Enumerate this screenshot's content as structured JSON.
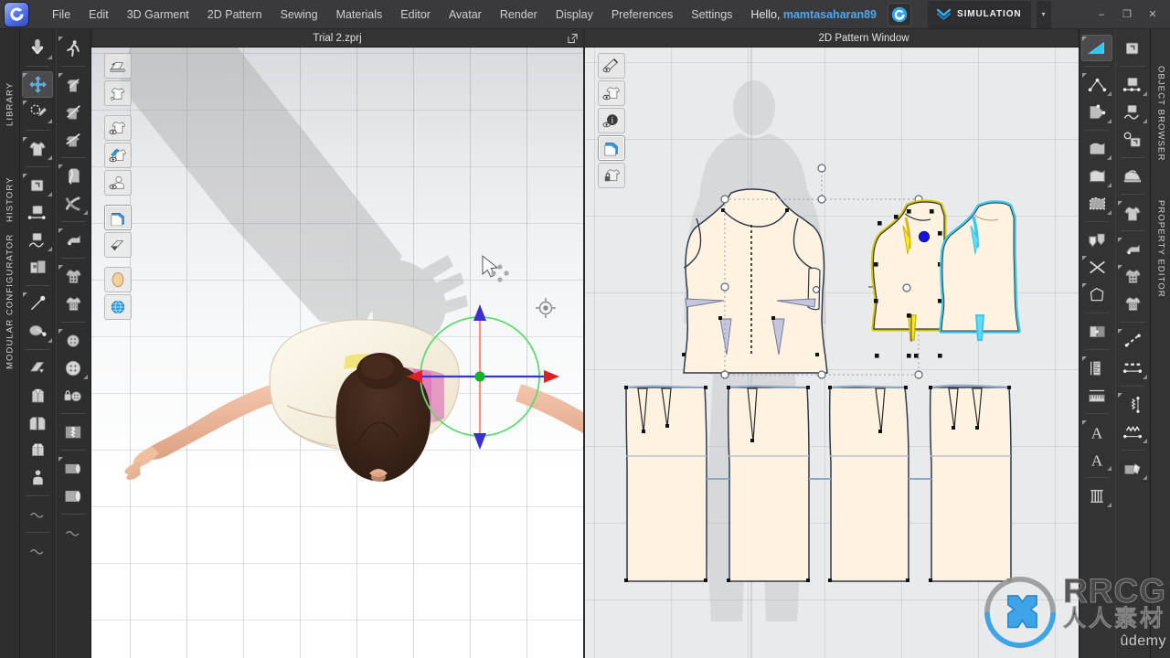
{
  "app": {
    "logo_icon": "clo-logo-icon",
    "window_controls": [
      {
        "name": "minimize",
        "glyph": "–"
      },
      {
        "name": "restore",
        "glyph": "❐"
      },
      {
        "name": "close",
        "glyph": "✕"
      }
    ]
  },
  "menubar": {
    "items": [
      {
        "label": "File"
      },
      {
        "label": "Edit"
      },
      {
        "label": "3D Garment"
      },
      {
        "label": "2D Pattern"
      },
      {
        "label": "Sewing"
      },
      {
        "label": "Materials"
      },
      {
        "label": "Editor"
      },
      {
        "label": "Avatar"
      },
      {
        "label": "Render"
      },
      {
        "label": "Display"
      },
      {
        "label": "Preferences"
      },
      {
        "label": "Settings"
      }
    ],
    "greeting_prefix": "Hello, ",
    "greeting_user": "mamtasaharan89",
    "account_icon": "clo-account-icon",
    "simulation_label": "SIMULATION",
    "simulation_icon": "simulation-chevrons-icon",
    "simulation_caret": "▾"
  },
  "left_rail": {
    "tabs": [
      {
        "label": "LIBRARY"
      },
      {
        "label": "HISTORY"
      },
      {
        "label": "MODULAR CONFIGURATOR"
      }
    ]
  },
  "right_rail": {
    "tabs": [
      {
        "label": "OBJECT BROWSER"
      },
      {
        "label": "PROPERTY EDITOR"
      }
    ]
  },
  "panels": {
    "viewport_3d": {
      "title": "Trial 2.zprj",
      "popout_icon": "popout-icon",
      "toolbar": [
        {
          "icon": "render-box-icon",
          "selected": false,
          "sub": false
        },
        {
          "icon": "garment-thumbnail-icon",
          "selected": false,
          "sub": false
        },
        {
          "icon": "show-garment-icon",
          "selected": false,
          "sub": false
        },
        {
          "icon": "show-stitch-icon",
          "selected": false,
          "sub": false
        },
        {
          "icon": "show-avatar-icon",
          "selected": false,
          "sub": false
        },
        {
          "icon": "show-pattern-icon",
          "selected": true,
          "sub": false
        },
        {
          "icon": "shade-mode-icon",
          "selected": false,
          "sub": false
        },
        {
          "icon": "avatar-head-icon",
          "selected": false,
          "sub": false
        },
        {
          "icon": "globe-environment-icon",
          "selected": false,
          "sub": false
        }
      ]
    },
    "viewport_2d": {
      "title": "2D Pattern Window",
      "popout_icon": "popout-icon",
      "toolbar": [
        {
          "icon": "show-baseline-icon",
          "selected": false
        },
        {
          "icon": "show-pattern-icon",
          "selected": false
        },
        {
          "icon": "show-info-icon",
          "selected": false
        },
        {
          "icon": "show-texture-icon",
          "selected": true
        },
        {
          "icon": "lock-pattern-icon",
          "selected": false
        }
      ]
    }
  },
  "left_toolbar": {
    "column_a": [
      {
        "icon": "simulate-arrow-icon",
        "arrow_br": true
      },
      {
        "sep": true
      },
      {
        "icon": "transform-move-icon",
        "selected": true,
        "arrow_tl": true
      },
      {
        "icon": "select-mesh-brush-icon",
        "arrow_tl": true,
        "arrow_br": true
      },
      {
        "sep": true
      },
      {
        "icon": "select-garment-icon",
        "arrow_tl": true,
        "arrow_br": true
      },
      {
        "sep": true
      },
      {
        "icon": "fold-arrange-icon",
        "arrow_tl": true,
        "arrow_br": true
      },
      {
        "icon": "segment-line-icon"
      },
      {
        "icon": "curve-pin-icon",
        "arrow_br": true
      },
      {
        "icon": "fabric-layer-icon"
      },
      {
        "sep": true
      },
      {
        "icon": "tape-measure-icon",
        "arrow_tl": true
      },
      {
        "icon": "circumference-measure-icon",
        "arrow_br": true
      },
      {
        "sep": true
      },
      {
        "icon": "flatten-icon"
      },
      {
        "icon": "zipper-garment-icon"
      },
      {
        "icon": "panel-pair-icon"
      },
      {
        "icon": "box-open-icon"
      },
      {
        "icon": "avatar-pose-icon"
      },
      {
        "sep": true
      },
      {
        "icon": "wave-tool-icon"
      },
      {
        "sep": true
      },
      {
        "icon": "wave-tool-2-icon"
      }
    ],
    "column_b": [
      {
        "icon": "walk-animation-icon",
        "arrow_tl": true
      },
      {
        "sep": true
      },
      {
        "icon": "pin-garment-icon",
        "arrow_tl": true
      },
      {
        "icon": "tack-garment-icon"
      },
      {
        "icon": "tack-pattern-icon"
      },
      {
        "sep": true
      },
      {
        "icon": "sew-free-icon",
        "arrow_tl": true
      },
      {
        "icon": "sew-segment-icon",
        "arrow_br": true
      },
      {
        "sep": true
      },
      {
        "icon": "fold-arrangement-icon",
        "arrow_tl": true
      },
      {
        "sep": true
      },
      {
        "icon": "button-add-icon",
        "arrow_tl": true
      },
      {
        "icon": "buttonhole-icon"
      },
      {
        "sep": true
      },
      {
        "icon": "button-place-icon",
        "arrow_tl": true
      },
      {
        "icon": "button-detail-icon",
        "arrow_br": true
      },
      {
        "icon": "lock-button-icon"
      },
      {
        "sep": true
      },
      {
        "icon": "zipper-icon"
      },
      {
        "sep": true
      },
      {
        "icon": "roll-fabric-icon",
        "arrow_tl": true
      },
      {
        "icon": "fabric-bolt-icon"
      },
      {
        "sep": true
      },
      {
        "icon": "wave-tool-icon"
      }
    ]
  },
  "right_toolbar": {
    "column_a": [
      {
        "icon": "polygon-select-icon",
        "selected": true,
        "arrow_tl": true
      },
      {
        "sep": true
      },
      {
        "icon": "edit-point-icon",
        "arrow_tl": true,
        "arrow_br": true
      },
      {
        "icon": "edit-curve-icon",
        "arrow_br": true
      },
      {
        "sep": true
      },
      {
        "icon": "pattern-shape-icon",
        "arrow_br": true
      },
      {
        "icon": "pattern-outline-icon",
        "arrow_br": true
      },
      {
        "icon": "pattern-marquee-icon",
        "arrow_br": true
      },
      {
        "sep": true
      },
      {
        "icon": "trace-shape-icon"
      },
      {
        "icon": "cut-scissors-icon",
        "arrow_tl": true
      },
      {
        "icon": "polygon-draw-icon",
        "arrow_tl": true
      },
      {
        "sep": true
      },
      {
        "icon": "fold-panel-icon"
      },
      {
        "sep": true
      },
      {
        "icon": "ruler-grade-icon",
        "arrow_tl": true
      },
      {
        "icon": "ruler-measure-icon"
      },
      {
        "sep": true
      },
      {
        "icon": "text-tool-icon",
        "arrow_tl": true
      },
      {
        "icon": "text-style-icon",
        "arrow_br": true
      },
      {
        "sep": true
      },
      {
        "icon": "pleat-icon",
        "arrow_br": true
      }
    ],
    "column_b": [
      {
        "icon": "pattern-fold-icon"
      },
      {
        "sep": true
      },
      {
        "icon": "segment-points-icon",
        "arrow_br": true
      },
      {
        "icon": "curve-segment-icon",
        "arrow_br": true
      },
      {
        "icon": "search-pattern-icon"
      },
      {
        "sep": true
      },
      {
        "icon": "iron-press-icon"
      },
      {
        "sep": true
      },
      {
        "icon": "tshirt-pattern-icon",
        "arrow_tl": true
      },
      {
        "sep": true
      },
      {
        "icon": "button-place-icon",
        "arrow_tl": true
      },
      {
        "icon": "button-detail-icon",
        "arrow_tl": true
      },
      {
        "icon": "buttonhole-panel-icon"
      },
      {
        "sep": true
      },
      {
        "icon": "topstitch-icon",
        "arrow_tl": true
      },
      {
        "icon": "stitch-dash-icon",
        "arrow_br": true
      },
      {
        "sep": true
      },
      {
        "icon": "zigzag-line-icon",
        "arrow_tl": true
      },
      {
        "icon": "zigzag-stitch-icon",
        "arrow_br": true
      },
      {
        "sep": true
      },
      {
        "icon": "print-layout-icon",
        "arrow_br": true
      }
    ]
  },
  "scene_3d": {
    "avatar_description": "female-avatar-top-view",
    "gizmo": {
      "axis_x_color": "#d92626",
      "axis_y_color": "#2a2ad6",
      "axis_z_color": "#ff7a70",
      "rotate_ring_color": "#58d46a",
      "center_color": "#18b12e"
    },
    "cursor_icon": "move-cursor-icon",
    "pivot_icon": "pivot-target-icon"
  },
  "scene_2d": {
    "selection_color": "#ffe81f",
    "secondary_color": "#66d9f5",
    "pattern_fill": "#fdf3e0",
    "pattern_stroke": "#3b4a63",
    "selected_point_color": "#2020d8",
    "pieces": [
      {
        "name": "bodice-front-full",
        "state": "normal"
      },
      {
        "name": "bodice-back-left",
        "state": "selected-yellow"
      },
      {
        "name": "bodice-back-right",
        "state": "highlight-cyan"
      },
      {
        "name": "skirt-panel-1",
        "state": "normal"
      },
      {
        "name": "skirt-panel-2",
        "state": "normal"
      },
      {
        "name": "skirt-panel-3",
        "state": "normal"
      },
      {
        "name": "skirt-panel-4",
        "state": "normal"
      }
    ]
  },
  "watermark": {
    "brand": "RRCG",
    "brand_cn": "人人素材",
    "platform": "ûdemy",
    "logo_icon": "rrcg-logo-icon"
  }
}
